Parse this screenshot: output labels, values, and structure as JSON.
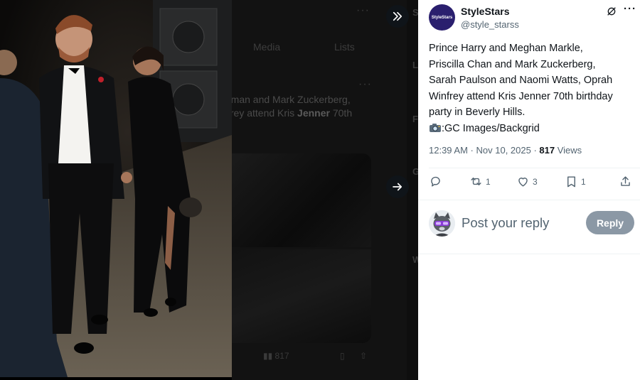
{
  "background_timeline": {
    "tab_media": "Media",
    "tab_lists": "Lists",
    "snippet_line1": "rman and Mark Zuckerberg,",
    "snippet_line2_a": "frey attend Kris ",
    "snippet_line2_b": "Jenner",
    "snippet_line2_c": " 70th",
    "views_short": "817"
  },
  "post": {
    "author_name": "StyleStars",
    "author_handle": "@style_starss",
    "avatar_text": "StyleStars",
    "text_lines": [
      "Prince Harry and Meghan Markle,",
      "Priscilla Chan and Mark Zuckerberg,",
      "Sarah Paulson and Naomi Watts, Oprah",
      "Winfrey attend Kris Jenner 70th birthday",
      "party in Beverly Hills."
    ],
    "credit": ":GC Images/Backgrid",
    "time": "12:39 AM",
    "date": "Nov 10, 2025",
    "views_count": "817",
    "views_label": "Views",
    "retweets": "1",
    "likes": "3",
    "bookmarks": "1"
  },
  "reply": {
    "placeholder": "Post your reply",
    "button_label": "Reply"
  },
  "icons": {
    "expand": "double-chevron-right-icon",
    "next": "arrow-right-icon",
    "grok": "grok-icon",
    "more": "more-icon",
    "reply": "reply-icon",
    "retweet": "retweet-icon",
    "like": "heart-icon",
    "bookmark": "bookmark-icon",
    "share": "share-icon"
  },
  "colors": {
    "text_primary": "#0f1419",
    "text_secondary": "#536471",
    "reply_button": "#8b98a5",
    "avatar_bg": "#2a1f6e"
  }
}
